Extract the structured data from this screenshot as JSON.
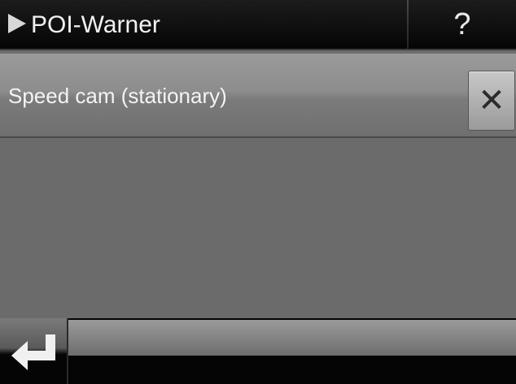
{
  "header": {
    "title": "POI-Warner",
    "help_label": "?"
  },
  "list": {
    "items": [
      {
        "label": "Speed cam (stationary)",
        "delete_icon": "close-x-icon"
      }
    ]
  },
  "footer": {
    "back_icon": "return-arrow-icon"
  },
  "colors": {
    "title_bar": "#0a0a0a",
    "content_bg": "#6b6b6b",
    "text": "#f2f2f2"
  }
}
